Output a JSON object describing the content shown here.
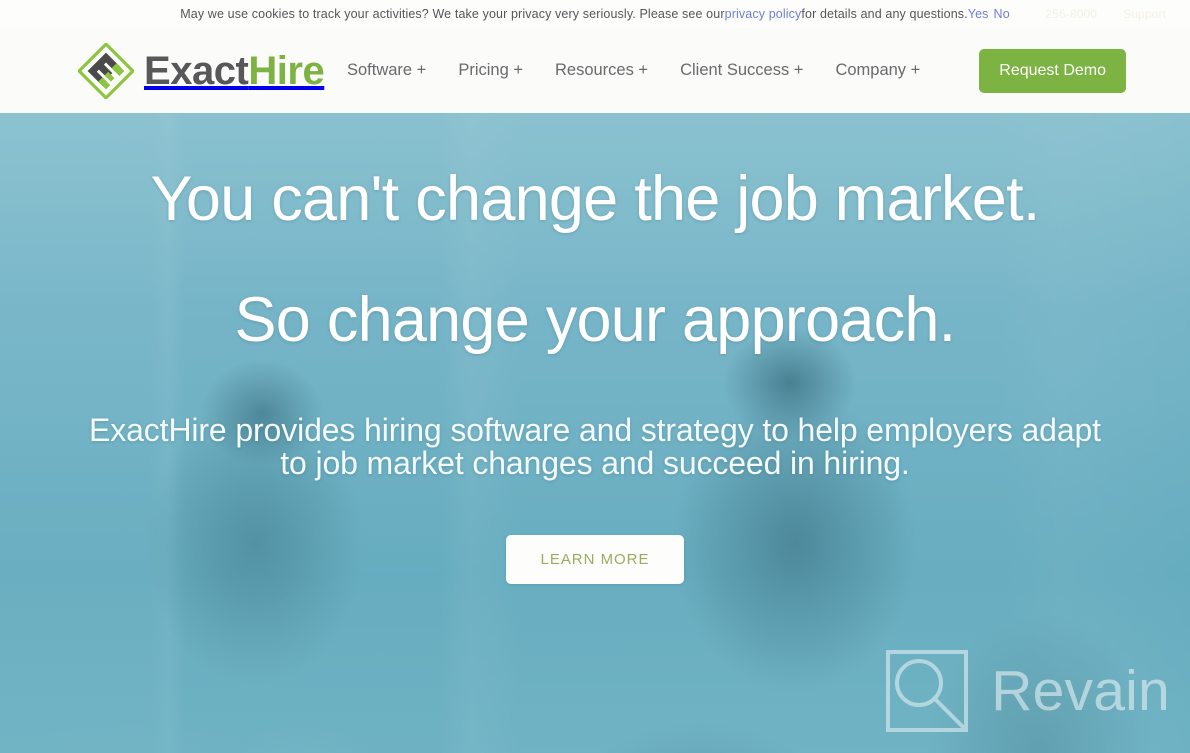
{
  "cookie_bar": {
    "message_part1": "May we use cookies to track your activities? We take your privacy very seriously. Please see our ",
    "privacy_link": "privacy policy",
    "message_part2": " for details and any questions.",
    "accept_label": "Yes",
    "decline_label": "No"
  },
  "utility_bar": {
    "phone": "256-8000",
    "support_label": "Support"
  },
  "header": {
    "brand": {
      "name_first": "Exact",
      "name_second": "Hire",
      "icon": "exacthire-diamond-logo",
      "color_dark": "#58585a",
      "color_green": "#7cb342"
    },
    "nav": [
      {
        "label": "Software +"
      },
      {
        "label": "Pricing +"
      },
      {
        "label": "Resources +"
      },
      {
        "label": "Client Success +"
      },
      {
        "label": "Company +"
      }
    ],
    "cta": {
      "label": "Request Demo",
      "color": "#7cb342"
    }
  },
  "hero": {
    "headline_line1": "You can't change the job market.",
    "headline_line2": "So change your approach.",
    "subheadline_line1": "ExactHire provides hiring software and strategy to help employers adapt",
    "subheadline_line2": "to job market changes and succeed in hiring.",
    "cta": {
      "label": "LEARN MORE",
      "text_color": "#9aab63",
      "background": "#fdfdfb"
    },
    "overlay_color": "#6eb0c3"
  },
  "watermark": {
    "text": "Revain",
    "icon": "revain-logo-icon"
  }
}
